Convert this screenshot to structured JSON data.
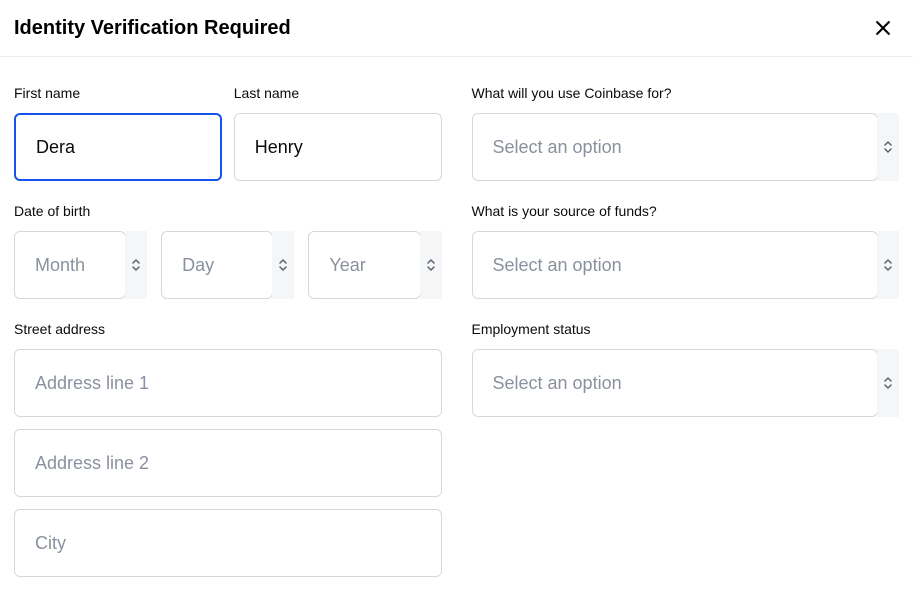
{
  "header": {
    "title": "Identity Verification Required"
  },
  "left": {
    "name": {
      "first_label": "First name",
      "last_label": "Last name",
      "first_value": "Dera",
      "last_value": "Henry"
    },
    "dob": {
      "label": "Date of birth",
      "month_placeholder": "Month",
      "day_placeholder": "Day",
      "year_placeholder": "Year"
    },
    "address": {
      "label": "Street address",
      "line1_placeholder": "Address line 1",
      "line2_placeholder": "Address line 2",
      "city_placeholder": "City"
    }
  },
  "right": {
    "use": {
      "label": "What will you use Coinbase for?",
      "placeholder": "Select an option"
    },
    "funds": {
      "label": "What is your source of funds?",
      "placeholder": "Select an option"
    },
    "employment": {
      "label": "Employment status",
      "placeholder": "Select an option"
    }
  }
}
